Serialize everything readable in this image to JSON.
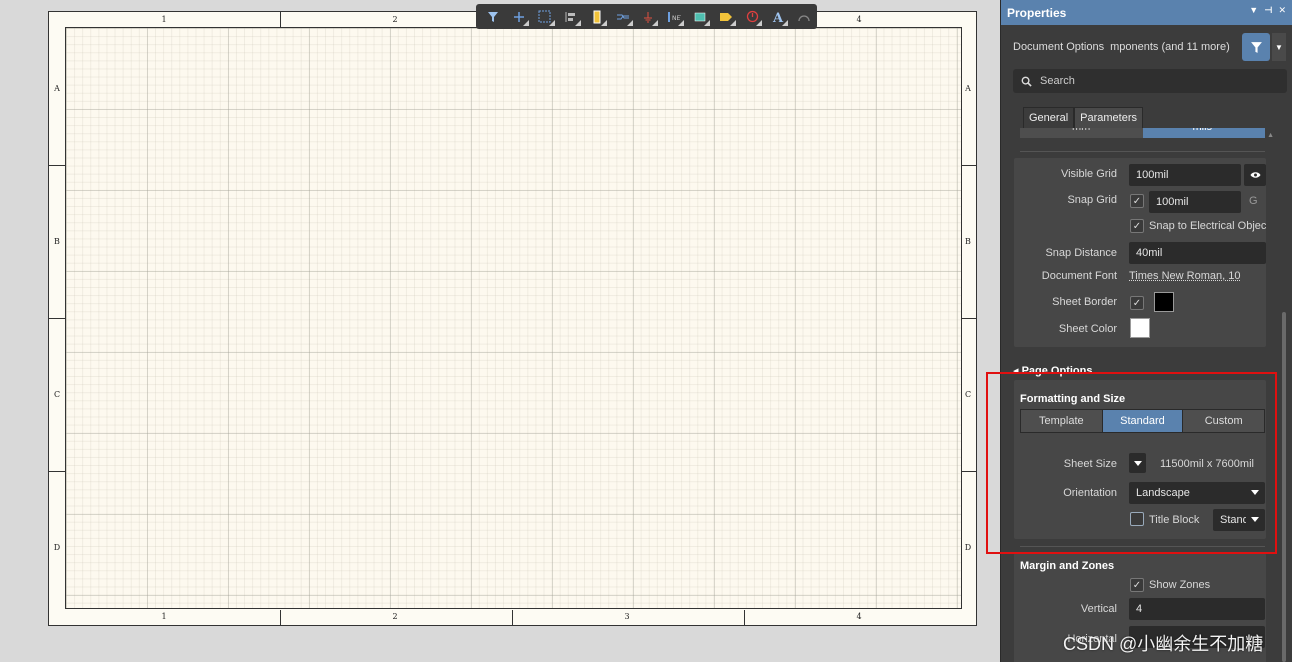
{
  "toolbar": {
    "icons": [
      "filter-icon",
      "cross-probe-icon",
      "select-rect-icon",
      "align-icon",
      "part-icon",
      "wire-icon",
      "ground-icon",
      "bus-icon",
      "net-label-icon",
      "port-icon",
      "no-erc-icon",
      "text-icon",
      "arc-icon"
    ]
  },
  "sheet": {
    "zones_top": [
      "1",
      "2",
      "3",
      "4"
    ],
    "zones_bottom": [
      "1",
      "2",
      "3",
      "4"
    ],
    "zones_left": [
      "A",
      "B",
      "C",
      "D"
    ],
    "zones_right": [
      "A",
      "B",
      "C",
      "D"
    ]
  },
  "panel": {
    "title": "Properties",
    "doc_options": "Document Options",
    "components_more": "mponents (and 11 more)",
    "search_placeholder": "Search",
    "tabs": [
      "General",
      "Parameters"
    ],
    "units_left": "mm",
    "units_right": "mils",
    "visible_grid_label": "Visible Grid",
    "visible_grid_value": "100mil",
    "snap_grid_label": "Snap Grid",
    "snap_grid_value": "100mil",
    "snap_grid_shortcut": "G",
    "snap_electrical": "Snap to Electrical Object",
    "snap_distance_label": "Snap Distance",
    "snap_distance_value": "40mil",
    "document_font_label": "Document Font",
    "document_font_value": "Times New Roman, 10",
    "sheet_border_label": "Sheet Border",
    "sheet_color_label": "Sheet Color",
    "page_options_title": "Page Options",
    "formatting_title": "Formatting and Size",
    "format_tabs": [
      "Template",
      "Standard",
      "Custom"
    ],
    "sheet_size_label": "Sheet Size",
    "sheet_size_value": "11500mil  x  7600mil",
    "orientation_label": "Orientation",
    "orientation_value": "Landscape",
    "title_block_label": "Title Block",
    "title_block_value": "Standard",
    "margin_title": "Margin and Zones",
    "show_zones": "Show Zones",
    "vertical_label": "Vertical",
    "vertical_value": "4",
    "horizontal_label": "Horizontal"
  },
  "watermark": "CSDN @小幽余生不加糖",
  "colors": {
    "accent": "#5a82ae",
    "highlight": "#e01010",
    "sheet_border_color": "#000000",
    "sheet_color": "#ffffff"
  }
}
